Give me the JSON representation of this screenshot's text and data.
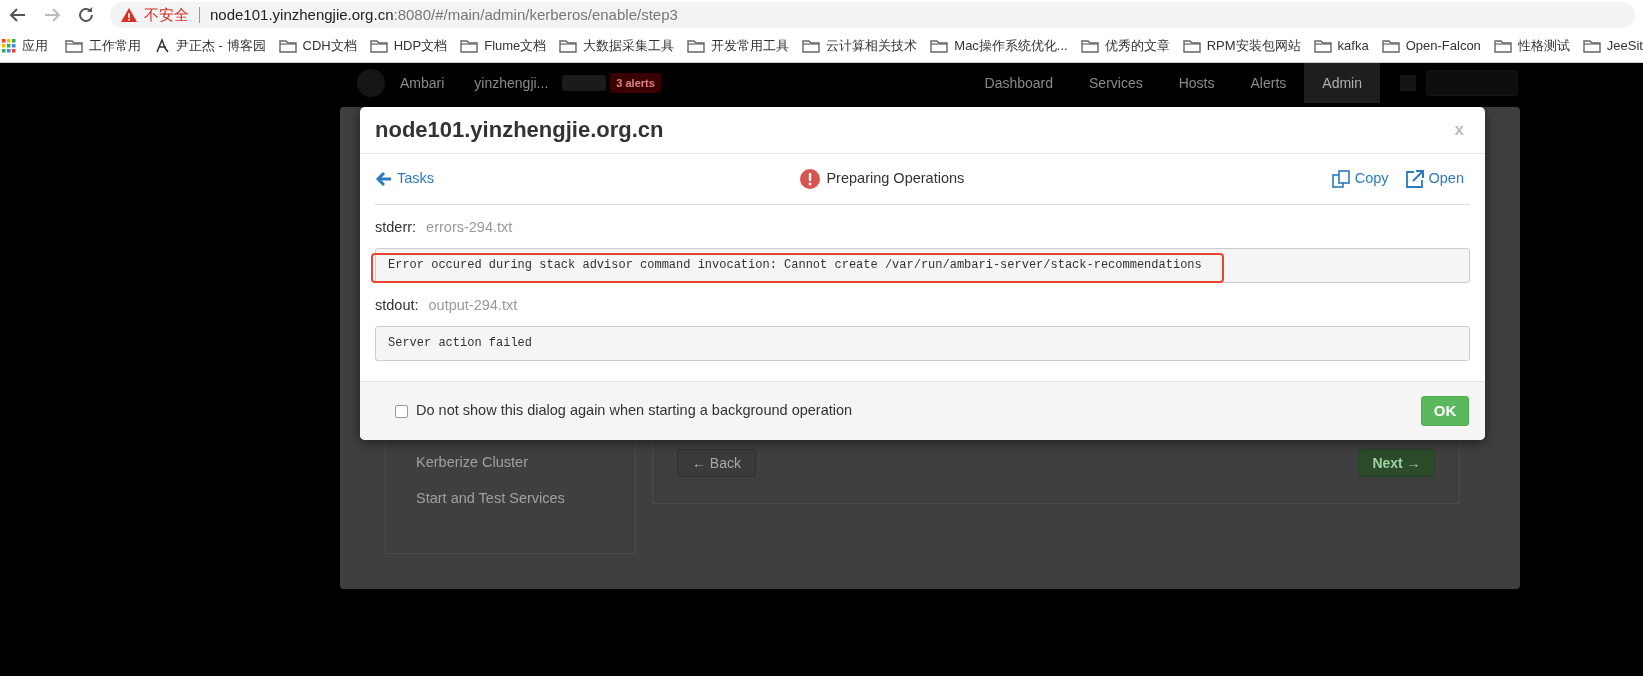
{
  "browser": {
    "security_label": "不安全",
    "url_host": "node101.yinzhengjie.org.cn",
    "url_rest": ":8080/#/main/admin/kerberos/enable/step3",
    "bookmarks": [
      {
        "label": "应用",
        "kind": "apps"
      },
      {
        "label": "工作常用",
        "kind": "folder"
      },
      {
        "label": "尹正杰 - 博客园",
        "kind": "site"
      },
      {
        "label": "CDH文档",
        "kind": "folder"
      },
      {
        "label": "HDP文档",
        "kind": "folder"
      },
      {
        "label": "Flume文档",
        "kind": "folder"
      },
      {
        "label": "大数据采集工具",
        "kind": "folder"
      },
      {
        "label": "开发常用工具",
        "kind": "folder"
      },
      {
        "label": "云计算相关技术",
        "kind": "folder"
      },
      {
        "label": "Mac操作系统优化...",
        "kind": "folder"
      },
      {
        "label": "优秀的文章",
        "kind": "folder"
      },
      {
        "label": "RPM安装包网站",
        "kind": "folder"
      },
      {
        "label": "kafka",
        "kind": "folder"
      },
      {
        "label": "Open-Falcon",
        "kind": "folder"
      },
      {
        "label": "性格测试",
        "kind": "folder"
      },
      {
        "label": "JeeSit",
        "kind": "folder"
      }
    ]
  },
  "navbar": {
    "brand": "Ambari",
    "cluster": "yinzhengji...",
    "alerts_badge": "3 alerts",
    "links": [
      {
        "label": "Dashboard",
        "selected": false
      },
      {
        "label": "Services",
        "selected": false
      },
      {
        "label": "Hosts",
        "selected": false
      },
      {
        "label": "Alerts",
        "selected": false
      },
      {
        "label": "Admin",
        "selected": true
      }
    ]
  },
  "wizard": {
    "steps": [
      "Kerberize Cluster",
      "Start and Test Services"
    ],
    "back_button": "← Back",
    "next_button": "Next →"
  },
  "dialog": {
    "title": "node101.yinzhengjie.org.cn",
    "close": "x",
    "back_link": "Tasks",
    "status": "Preparing Operations",
    "copy_link": "Copy",
    "open_link": "Open",
    "logs": [
      {
        "label": "stderr:",
        "file": "errors-294.txt",
        "text": "Error occured during stack advisor command invocation: Cannot create /var/run/ambari-server/stack-recommendations",
        "highlighted": true
      },
      {
        "label": "stdout:",
        "file": "output-294.txt",
        "text": "Server action failed",
        "highlighted": false
      }
    ],
    "footer": {
      "checkbox_label": "Do not show this dialog again when starting a background operation",
      "checked": false
    },
    "ok_button": "OK"
  }
}
